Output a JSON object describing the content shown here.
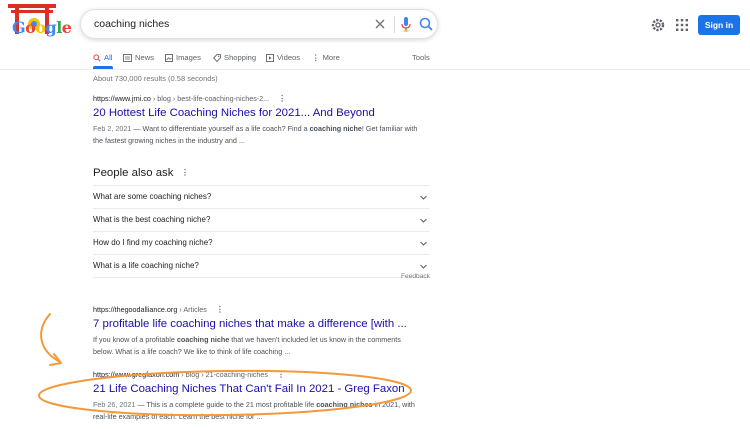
{
  "header": {
    "logo_text": "Google",
    "search_query": "coaching niches",
    "signin_label": "Sign in"
  },
  "icons": {
    "clear": "close-icon",
    "mic": "microphone-icon",
    "search": "search-icon",
    "settings": "gear-icon",
    "apps": "apps-grid-icon"
  },
  "colors": {
    "link": "#1a0dab",
    "accent": "#1a73e8",
    "annotation": "#f29a3b"
  },
  "tabs": [
    {
      "label": "All",
      "active": true
    },
    {
      "label": "News"
    },
    {
      "label": "Images"
    },
    {
      "label": "Shopping"
    },
    {
      "label": "Videos"
    },
    {
      "label": "More"
    }
  ],
  "tools_label": "Tools",
  "stats": "About 730,000 results (0.58 seconds)",
  "results": [
    {
      "url": "https://www.jrni.co",
      "crumb": " › blog › best-life-coaching-niches-2...",
      "title": "20 Hottest Life Coaching Niches for 2021... And Beyond",
      "date": "Feb 2, 2021",
      "snippet_pre": " — Want to differentiate yourself as a life coach? Find a ",
      "snippet_bold": "coaching niche",
      "snippet_post": "! Get familiar with the fastest growing niches in the industry and ..."
    },
    {
      "url": "https://thegoodalliance.org",
      "crumb": " › Articles",
      "title": "7 profitable life coaching niches that make a difference [with ...",
      "snippet_pre": "If you know of a profitable ",
      "snippet_bold": "coaching niche",
      "snippet_post": " that we haven't included let us know in the comments below. What is a life coach? We like to think of life coaching ..."
    },
    {
      "url": "https://www.gregfaxon.com",
      "crumb": " › blog › 21-coaching-niches",
      "title": "21 Life Coaching Niches That Can't Fail In 2021 - Greg Faxon",
      "date": "Feb 26, 2021",
      "snippet_pre": " — This is a complete guide to the 21 most profitable life ",
      "snippet_bold": "coaching niches",
      "snippet_post": " in 2021, with real-life examples of each. Learn the best niche for ..."
    }
  ],
  "paa": {
    "title": "People also ask",
    "questions": [
      "What are some coaching niches?",
      "What is the best coaching niche?",
      "How do I find my coaching niche?",
      "What is a life coaching niche?"
    ],
    "feedback": "Feedback"
  }
}
